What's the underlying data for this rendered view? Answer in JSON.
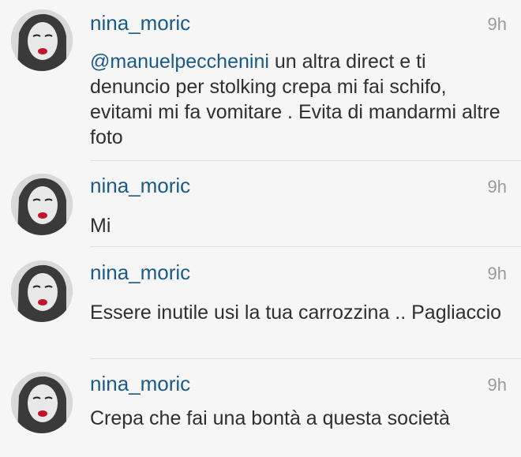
{
  "comments": [
    {
      "username": "nina_moric",
      "time": "9h",
      "mention": "@manuelpecchenini",
      "text": " un altra direct e ti denuncio per stolking crepa mi fai schifo, evitami mi fa vomitare . Evita di mandarmi altre foto"
    },
    {
      "username": "nina_moric",
      "time": "9h",
      "text": "Mi"
    },
    {
      "username": "nina_moric",
      "time": "9h",
      "text": "Essere inutile usi la tua carrozzina .. Pagliaccio"
    },
    {
      "username": "nina_moric",
      "time": "9h",
      "text": "Crepa che fai una bontà a questa società"
    }
  ],
  "colors": {
    "background": "#f6f6f6",
    "username": "#1a5a86",
    "text": "#2f2f2f",
    "timestamp": "#9a9a9a"
  },
  "icons": {
    "avatar": "profile-photo-avatar"
  }
}
